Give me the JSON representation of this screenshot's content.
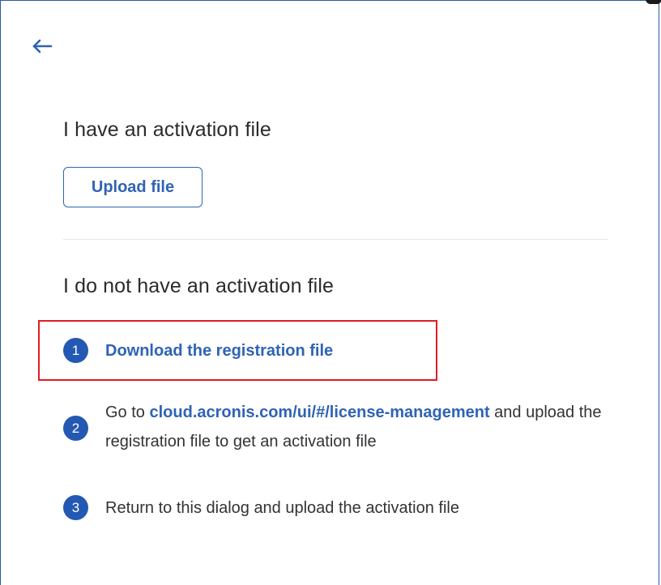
{
  "header": {
    "back_icon": "arrow-left-icon"
  },
  "activation": {
    "has_file_title": "I have an activation file",
    "upload_label": "Upload file",
    "no_file_title": "I do not have an activation file"
  },
  "steps": [
    {
      "number": "1",
      "link_text": "Download the registration file"
    },
    {
      "number": "2",
      "prefix": "Go to ",
      "link_text": "cloud.acronis.com/ui/#/license-management",
      "suffix": " and upload the registration file to get an activation file"
    },
    {
      "number": "3",
      "text": "Return to this dialog and upload the activation file"
    }
  ],
  "colors": {
    "accent": "#2f63b5",
    "step_badge": "#2459b3",
    "highlight": "#e01b24",
    "frame_border": "#2a5aa8"
  }
}
